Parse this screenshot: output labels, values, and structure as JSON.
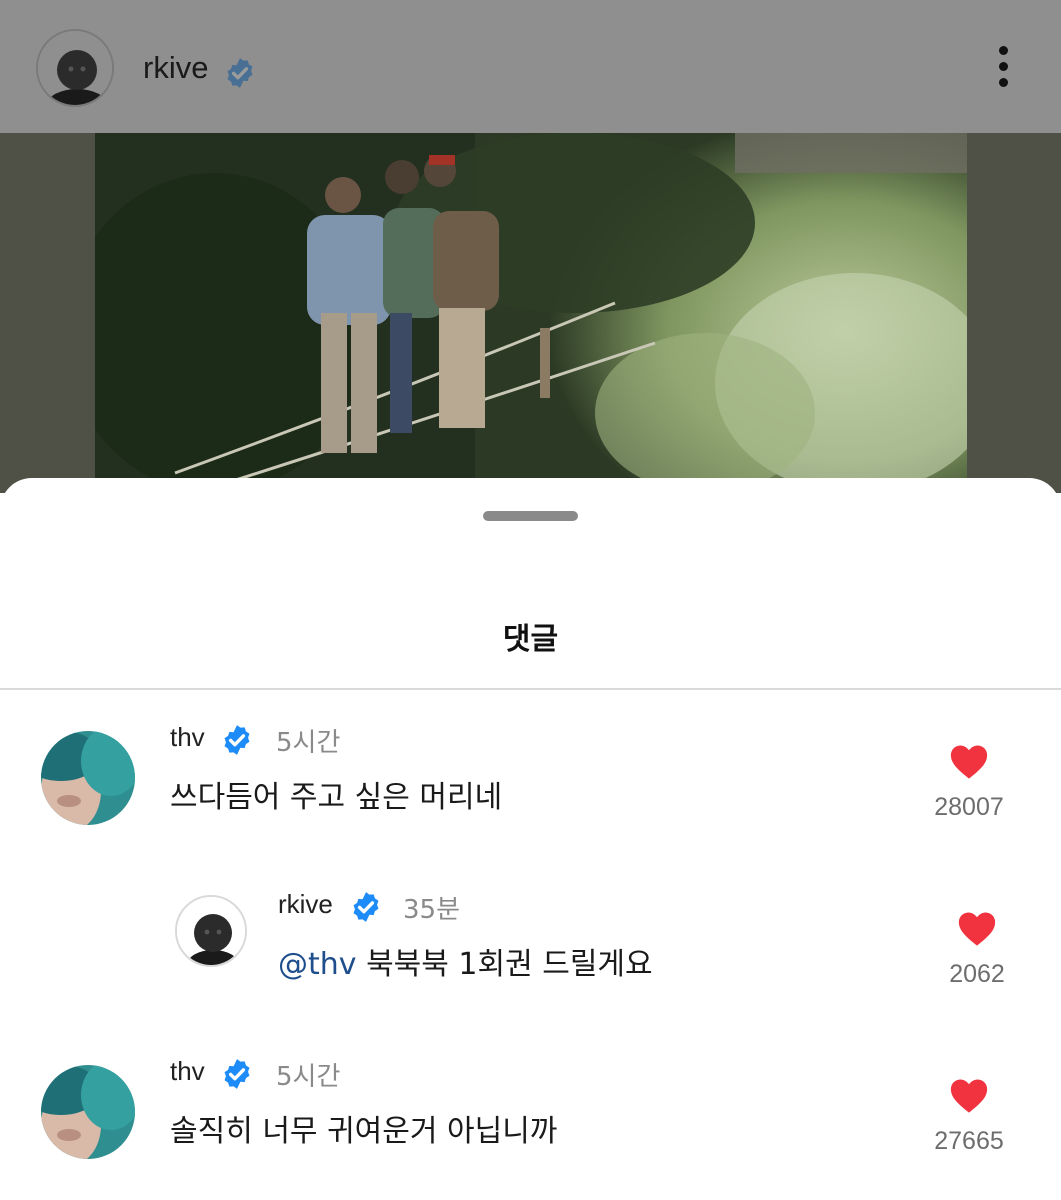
{
  "post": {
    "username": "rkive"
  },
  "sheet": {
    "title": "댓글"
  },
  "comments": [
    {
      "username": "thv",
      "time": "5시간",
      "text": "쓰다듬어 주고 싶은 머리네",
      "likes": "28007"
    },
    {
      "username": "rkive",
      "time": "35분",
      "mention": "@thv",
      "text": " 북북북 1회권 드릴게요",
      "likes": "2062"
    },
    {
      "username": "thv",
      "time": "5시간",
      "text": "솔직히 너무 귀여운거 아닙니까",
      "likes": "27665"
    }
  ],
  "colors": {
    "verified": "#1d8cf8",
    "like": "#f0333f",
    "mention": "#1f4e8c"
  },
  "icons": {
    "verified": "verified-badge-icon",
    "like": "heart-icon",
    "more": "more-vertical-icon"
  }
}
